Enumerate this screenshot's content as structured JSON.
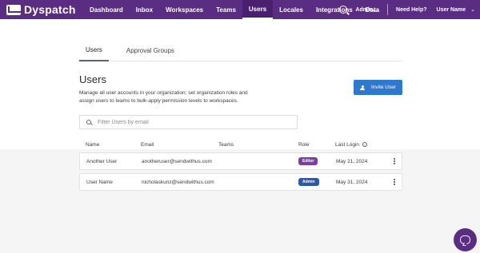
{
  "header": {
    "brand": "Dyspatch",
    "nav": [
      {
        "label": "Dashboard",
        "active": false
      },
      {
        "label": "Inbox",
        "active": false
      },
      {
        "label": "Workspaces",
        "active": false
      },
      {
        "label": "Teams",
        "active": false
      },
      {
        "label": "Users",
        "active": true
      },
      {
        "label": "Locales",
        "active": false
      },
      {
        "label": "Integrations",
        "active": false
      },
      {
        "label": "Data",
        "active": false
      }
    ],
    "admin_label": "Admin...",
    "help_label": "Need Help?",
    "user_label": "User Name",
    "colors": {
      "bar": "#5a2d82",
      "active_tab": "#4a1f70"
    }
  },
  "tabs": [
    {
      "label": "Users",
      "active": true
    },
    {
      "label": "Approval Groups",
      "active": false
    }
  ],
  "page": {
    "title": "Users",
    "description": "Manage all user accounts in your organization; set organization roles and assign users to teams to bulk-apply permission levels to workspaces.",
    "invite_label": "Invite User",
    "filter_placeholder": "Filter Users by email"
  },
  "table": {
    "columns": [
      "Name",
      "Email",
      "Teams",
      "Role",
      "Last Login"
    ],
    "rows": [
      {
        "name": "Another User",
        "email": "anotheruser@sendwithus.com",
        "teams": "",
        "role": "Editor",
        "role_color": "#7b3fa0",
        "last_login": "May 21, 2024"
      },
      {
        "name": "User Name",
        "email": "nicholaskunz@sendwithus.com",
        "teams": "",
        "role": "Admin",
        "role_color": "#2b58a8",
        "last_login": "May 31, 2024"
      }
    ]
  },
  "icons": {
    "logo": "envelope-logo-icon",
    "search": "search-icon",
    "chevron": "chevron-down-icon",
    "invite": "add-user-icon",
    "filter": "search-icon",
    "info": "info-icon",
    "row_menu": "kebab-menu-icon",
    "chat": "chat-bubble-icon"
  }
}
